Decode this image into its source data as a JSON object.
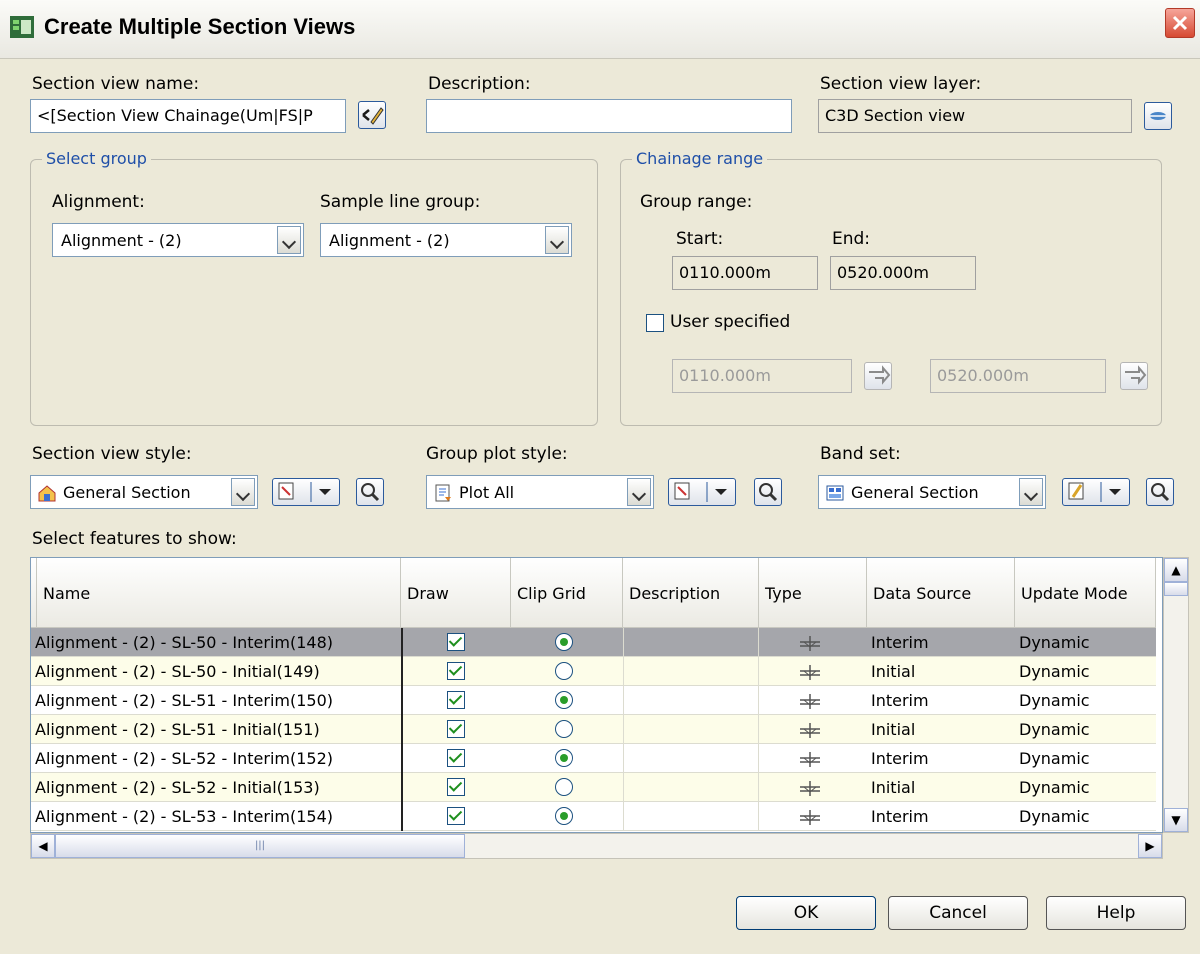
{
  "window": {
    "title": "Create Multiple Section Views",
    "icon": "app-icon",
    "close_icon": "close-icon"
  },
  "fields": {
    "section_view_name_label": "Section view name:",
    "section_view_name_value": "<[Section View Chainage(Um|FS|P",
    "description_label": "Description:",
    "description_value": "",
    "section_view_layer_label": "Section view layer:",
    "section_view_layer_value": "C3D Section view"
  },
  "select_group": {
    "legend": "Select group",
    "alignment_label": "Alignment:",
    "alignment_value": "Alignment - (2)",
    "sample_line_group_label": "Sample line group:",
    "sample_line_group_value": "Alignment - (2)"
  },
  "chainage_range": {
    "legend": "Chainage range",
    "group_range_label": "Group range:",
    "start_label": "Start:",
    "end_label": "End:",
    "start_value": "0110.000m",
    "end_value": "0520.000m",
    "user_specified_label": "User specified",
    "user_specified_checked": false,
    "user_start_value": "0110.000m",
    "user_end_value": "0520.000m"
  },
  "styles": {
    "section_view_style_label": "Section view style:",
    "section_view_style_value": "General Section",
    "group_plot_style_label": "Group plot style:",
    "group_plot_style_value": "Plot All",
    "band_set_label": "Band set:",
    "band_set_value": "General Section"
  },
  "features": {
    "label": "Select features to show:",
    "columns": [
      "Name",
      "Draw",
      "Clip Grid",
      "Description",
      "Type",
      "Data Source",
      "Update Mode"
    ],
    "rows": [
      {
        "name": "Alignment - (2) - SL-50 - Interim(148)",
        "draw": true,
        "clip": true,
        "description": "",
        "source": "Interim",
        "mode": "Dynamic"
      },
      {
        "name": "Alignment - (2) - SL-50 - Initial(149)",
        "draw": true,
        "clip": false,
        "description": "",
        "source": "Initial",
        "mode": "Dynamic"
      },
      {
        "name": "Alignment - (2) - SL-51 - Interim(150)",
        "draw": true,
        "clip": true,
        "description": "",
        "source": "Interim",
        "mode": "Dynamic"
      },
      {
        "name": "Alignment - (2) - SL-51 - Initial(151)",
        "draw": true,
        "clip": false,
        "description": "",
        "source": "Initial",
        "mode": "Dynamic"
      },
      {
        "name": "Alignment - (2) - SL-52 - Interim(152)",
        "draw": true,
        "clip": true,
        "description": "",
        "source": "Interim",
        "mode": "Dynamic"
      },
      {
        "name": "Alignment - (2) - SL-52 - Initial(153)",
        "draw": true,
        "clip": false,
        "description": "",
        "source": "Initial",
        "mode": "Dynamic"
      },
      {
        "name": "Alignment - (2) - SL-53 - Interim(154)",
        "draw": true,
        "clip": true,
        "description": "",
        "source": "Interim",
        "mode": "Dynamic"
      }
    ]
  },
  "buttons": {
    "ok": "OK",
    "cancel": "Cancel",
    "help": "Help"
  },
  "colors": {
    "selected_row": "#a5a6ab",
    "alt_row": "#fdfde9",
    "legend_blue": "#1f4fa8"
  }
}
